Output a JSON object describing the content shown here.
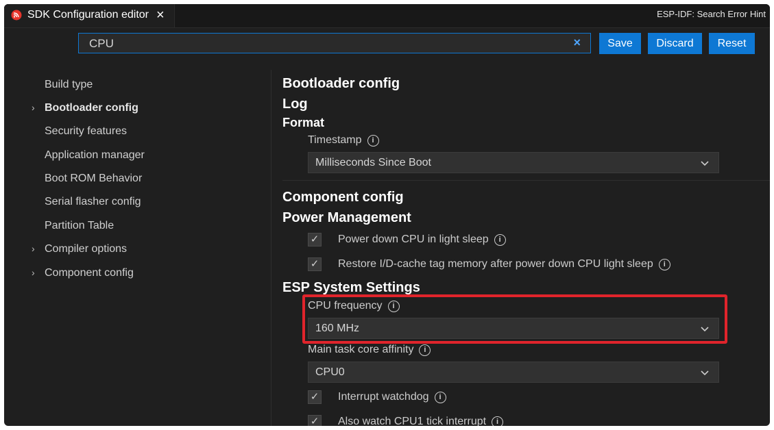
{
  "tab": {
    "title": "SDK Configuration editor",
    "close_icon": "×",
    "icon": "espressif-logo-icon"
  },
  "header_hint": "ESP-IDF: Search Error Hint",
  "search": {
    "value": "CPU",
    "clear_icon": "×"
  },
  "buttons": {
    "save": "Save",
    "discard": "Discard",
    "reset": "Reset"
  },
  "sidebar": {
    "items": [
      {
        "label": "Build type",
        "expandable": false,
        "selected": false
      },
      {
        "label": "Bootloader config",
        "expandable": true,
        "selected": true
      },
      {
        "label": "Security features",
        "expandable": false,
        "selected": false
      },
      {
        "label": "Application manager",
        "expandable": false,
        "selected": false
      },
      {
        "label": "Boot ROM Behavior",
        "expandable": false,
        "selected": false
      },
      {
        "label": "Serial flasher config",
        "expandable": false,
        "selected": false
      },
      {
        "label": "Partition Table",
        "expandable": false,
        "selected": false
      },
      {
        "label": "Compiler options",
        "expandable": true,
        "selected": false
      },
      {
        "label": "Component config",
        "expandable": true,
        "selected": false
      }
    ]
  },
  "main": {
    "bootloader_title": "Bootloader config",
    "log_title": "Log",
    "format_title": "Format",
    "timestamp_label": "Timestamp",
    "timestamp_value": "Milliseconds Since Boot",
    "component_title": "Component config",
    "power_title": "Power Management",
    "power_down_cpu": "Power down CPU in light sleep",
    "restore_cache": "Restore I/D-cache tag memory after power down CPU light sleep",
    "esp_system_title": "ESP System Settings",
    "cpu_freq_label": "CPU frequency",
    "cpu_freq_value": "160 MHz",
    "main_task_label": "Main task core affinity",
    "main_task_value": "CPU0",
    "interrupt_wd": "Interrupt watchdog",
    "watch_cpu1": "Also watch CPU1 tick interrupt",
    "info_glyph": "i",
    "check_glyph": "✓"
  },
  "colors": {
    "accent": "#0e78d4",
    "highlight": "#e0242b",
    "background": "#1f1f1f"
  }
}
